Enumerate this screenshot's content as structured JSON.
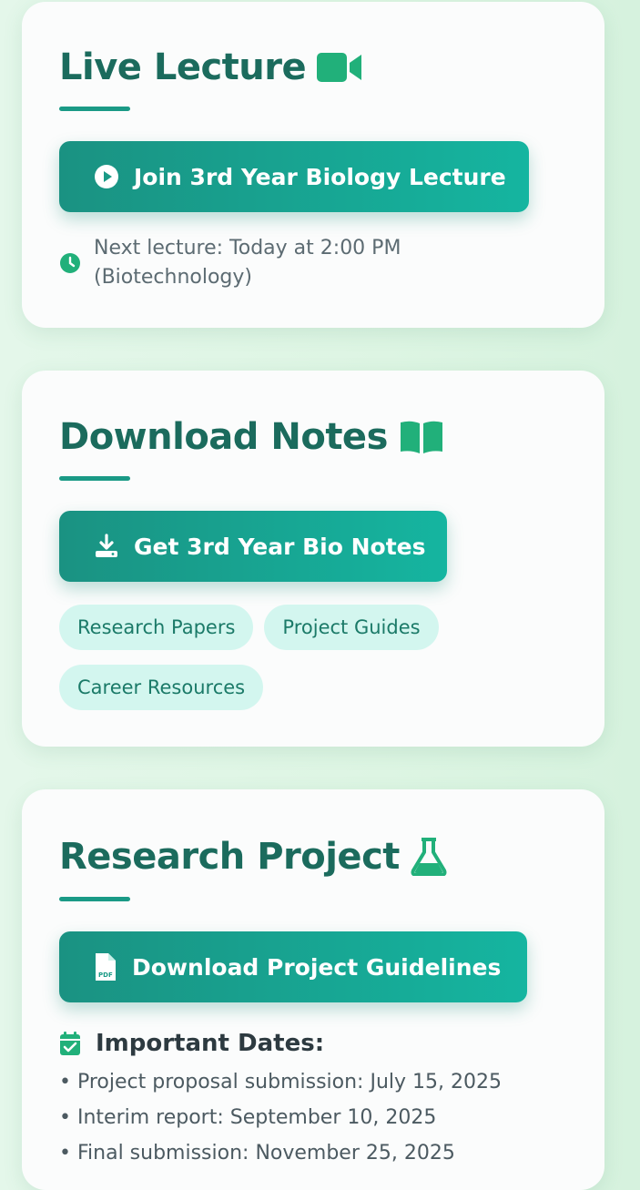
{
  "live_lecture": {
    "title": "Live Lecture",
    "title_icon": "video-camera-icon",
    "join_button": "Join 3rd Year Biology Lecture",
    "join_icon": "play-circle-icon",
    "next_lecture_icon": "clock-icon",
    "next_lecture_line1": "Next lecture: Today at 2:00 PM",
    "next_lecture_line2": "(Biotechnology)"
  },
  "download_notes": {
    "title": "Download Notes",
    "title_icon": "open-book-icon",
    "notes_button": "Get 3rd Year Bio Notes",
    "notes_icon": "download-icon",
    "chips": [
      "Research Papers",
      "Project Guides",
      "Career Resources"
    ]
  },
  "research_project": {
    "title": "Research Project",
    "title_icon": "flask-icon",
    "guidelines_button": "Download Project Guidelines",
    "guidelines_icon": "pdf-file-icon",
    "dates_icon": "calendar-check-icon",
    "dates_heading": "Important Dates:",
    "dates": [
      "Project proposal submission: July 15, 2025",
      "Interim report: September 10, 2025",
      "Final submission: November 25, 2025"
    ]
  },
  "colors": {
    "title": "#1b6b5d",
    "accent": "#1a9a86",
    "button_gradient_start": "#1a9282",
    "button_gradient_end": "#15b5a0",
    "chip_bg": "#d3f6ef",
    "chip_text": "#1b7a68",
    "icon_green": "#21b07a"
  }
}
